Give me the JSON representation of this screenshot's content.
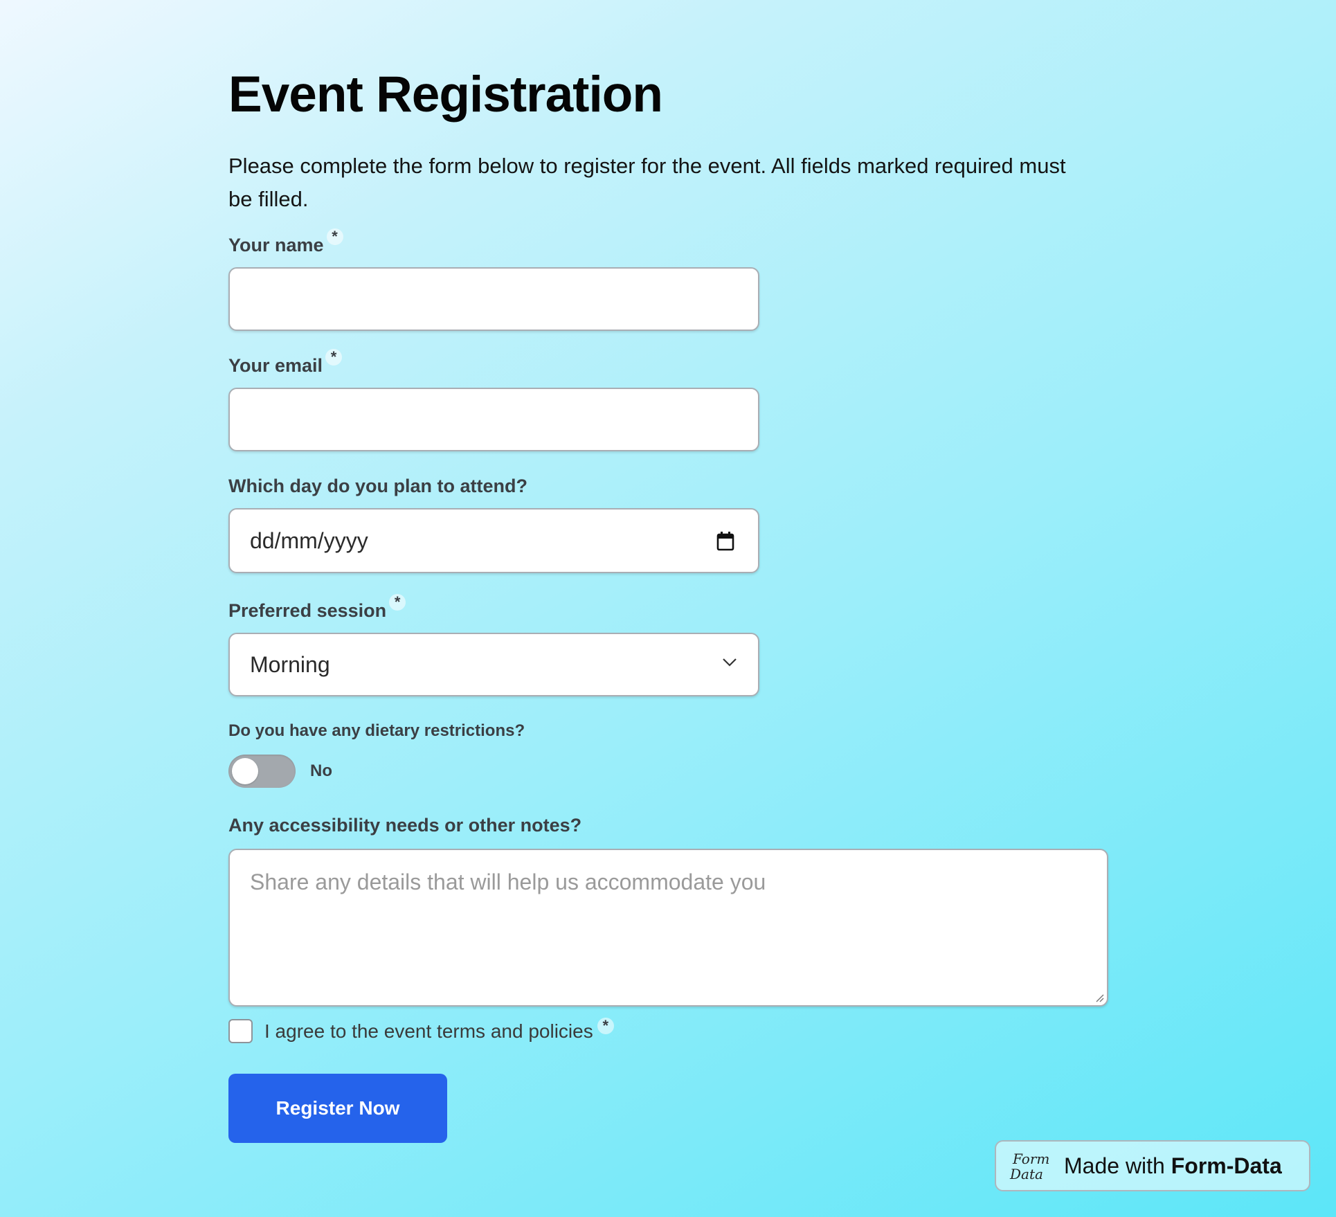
{
  "form": {
    "title": "Event Registration",
    "intro": "Please complete the form below to register for the event. All fields marked required must be filled.",
    "required_mark": "*",
    "name": {
      "label": "Your name",
      "value": ""
    },
    "email": {
      "label": "Your email",
      "value": ""
    },
    "date": {
      "label": "Which day do you plan to attend?",
      "placeholder": "dd/mm/yyyy"
    },
    "session": {
      "label": "Preferred session",
      "selected": "Morning"
    },
    "dietary": {
      "label": "Do you have any dietary restrictions?",
      "toggle_state": "No"
    },
    "notes": {
      "label": "Any accessibility needs or other notes?",
      "placeholder": "Share any details that will help us accommodate you"
    },
    "terms": {
      "label": "I agree to the event terms and policies",
      "checked": false
    },
    "submit_label": "Register Now"
  },
  "badge": {
    "prefix": "Made with",
    "brand": "Form-Data",
    "logo_text": "Form Data"
  },
  "colors": {
    "primary": "#2563eb",
    "toggle_off": "#a3a8ad"
  },
  "icons": {
    "calendar": "calendar-icon",
    "dropdown": "chevron-down-icon"
  }
}
